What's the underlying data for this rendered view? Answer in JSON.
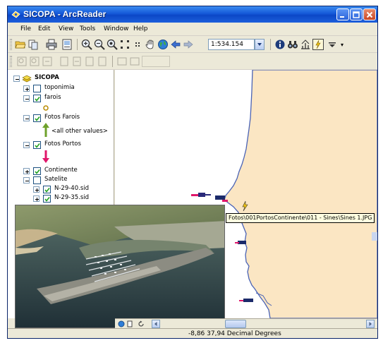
{
  "window": {
    "title": "SICOPA - ArcReader"
  },
  "menu": {
    "items": [
      "File",
      "Edit",
      "View",
      "Tools",
      "Window",
      "Help"
    ]
  },
  "toolbar": {
    "scale_value": "1:534.154"
  },
  "toc": {
    "root": "SICOPA",
    "toponimia": "toponimia",
    "farois": "farois",
    "fotos_farois": "Fotos Farois",
    "all_other_values": "<all other values>",
    "fotos_portos": "Fotos Portos",
    "continente": "Continente",
    "satelite": "Satelite",
    "sid_1": "N-29-40.sid",
    "sid_2": "N-29-35.sid"
  },
  "map": {
    "tooltip": "Fotos\\001PortosContinente\\011 - Sines\\Sines 1.JPG",
    "land_color": "#fbe6c3",
    "sea_color": "#ffffff",
    "coast_color": "#4a63b5"
  },
  "status": {
    "coordinates": "-8,86  37,94 Decimal Degrees"
  },
  "icons": [
    "app-icon",
    "minimize-icon",
    "maximize-icon",
    "close-icon",
    "open-icon",
    "print-icon",
    "zoom-in-icon",
    "zoom-out-icon",
    "pan-icon",
    "globe-icon",
    "back-icon",
    "forward-icon",
    "identify-icon",
    "find-icon",
    "measure-icon",
    "hyperlink-icon"
  ]
}
